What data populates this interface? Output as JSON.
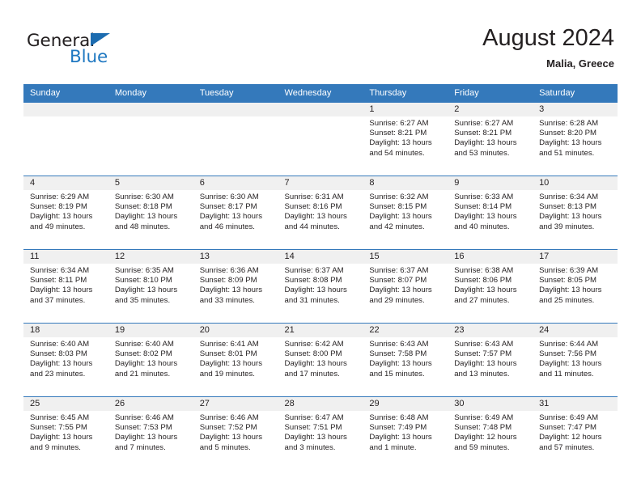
{
  "logo": {
    "word_top": "General",
    "word_bottom": "Blue",
    "triangle_color": "#1c6cb0",
    "blue_color": "#1f78c1"
  },
  "header": {
    "title": "August 2024",
    "subtitle": "Malia, Greece"
  },
  "theme": {
    "header_bg": "#3479bb",
    "daynum_bg": "#f0f0f0",
    "text": "#231f20",
    "grid_line": "#3479bb"
  },
  "weekday_headers": [
    "Sunday",
    "Monday",
    "Tuesday",
    "Wednesday",
    "Thursday",
    "Friday",
    "Saturday"
  ],
  "weeks": [
    [
      {
        "day": "",
        "empty": true
      },
      {
        "day": "",
        "empty": true
      },
      {
        "day": "",
        "empty": true
      },
      {
        "day": "",
        "empty": true
      },
      {
        "day": "1",
        "sunrise": "Sunrise: 6:27 AM",
        "sunset": "Sunset: 8:21 PM",
        "daylight": "Daylight: 13 hours and 54 minutes."
      },
      {
        "day": "2",
        "sunrise": "Sunrise: 6:27 AM",
        "sunset": "Sunset: 8:21 PM",
        "daylight": "Daylight: 13 hours and 53 minutes."
      },
      {
        "day": "3",
        "sunrise": "Sunrise: 6:28 AM",
        "sunset": "Sunset: 8:20 PM",
        "daylight": "Daylight: 13 hours and 51 minutes."
      }
    ],
    [
      {
        "day": "4",
        "sunrise": "Sunrise: 6:29 AM",
        "sunset": "Sunset: 8:19 PM",
        "daylight": "Daylight: 13 hours and 49 minutes."
      },
      {
        "day": "5",
        "sunrise": "Sunrise: 6:30 AM",
        "sunset": "Sunset: 8:18 PM",
        "daylight": "Daylight: 13 hours and 48 minutes."
      },
      {
        "day": "6",
        "sunrise": "Sunrise: 6:30 AM",
        "sunset": "Sunset: 8:17 PM",
        "daylight": "Daylight: 13 hours and 46 minutes."
      },
      {
        "day": "7",
        "sunrise": "Sunrise: 6:31 AM",
        "sunset": "Sunset: 8:16 PM",
        "daylight": "Daylight: 13 hours and 44 minutes."
      },
      {
        "day": "8",
        "sunrise": "Sunrise: 6:32 AM",
        "sunset": "Sunset: 8:15 PM",
        "daylight": "Daylight: 13 hours and 42 minutes."
      },
      {
        "day": "9",
        "sunrise": "Sunrise: 6:33 AM",
        "sunset": "Sunset: 8:14 PM",
        "daylight": "Daylight: 13 hours and 40 minutes."
      },
      {
        "day": "10",
        "sunrise": "Sunrise: 6:34 AM",
        "sunset": "Sunset: 8:13 PM",
        "daylight": "Daylight: 13 hours and 39 minutes."
      }
    ],
    [
      {
        "day": "11",
        "sunrise": "Sunrise: 6:34 AM",
        "sunset": "Sunset: 8:11 PM",
        "daylight": "Daylight: 13 hours and 37 minutes."
      },
      {
        "day": "12",
        "sunrise": "Sunrise: 6:35 AM",
        "sunset": "Sunset: 8:10 PM",
        "daylight": "Daylight: 13 hours and 35 minutes."
      },
      {
        "day": "13",
        "sunrise": "Sunrise: 6:36 AM",
        "sunset": "Sunset: 8:09 PM",
        "daylight": "Daylight: 13 hours and 33 minutes."
      },
      {
        "day": "14",
        "sunrise": "Sunrise: 6:37 AM",
        "sunset": "Sunset: 8:08 PM",
        "daylight": "Daylight: 13 hours and 31 minutes."
      },
      {
        "day": "15",
        "sunrise": "Sunrise: 6:37 AM",
        "sunset": "Sunset: 8:07 PM",
        "daylight": "Daylight: 13 hours and 29 minutes."
      },
      {
        "day": "16",
        "sunrise": "Sunrise: 6:38 AM",
        "sunset": "Sunset: 8:06 PM",
        "daylight": "Daylight: 13 hours and 27 minutes."
      },
      {
        "day": "17",
        "sunrise": "Sunrise: 6:39 AM",
        "sunset": "Sunset: 8:05 PM",
        "daylight": "Daylight: 13 hours and 25 minutes."
      }
    ],
    [
      {
        "day": "18",
        "sunrise": "Sunrise: 6:40 AM",
        "sunset": "Sunset: 8:03 PM",
        "daylight": "Daylight: 13 hours and 23 minutes."
      },
      {
        "day": "19",
        "sunrise": "Sunrise: 6:40 AM",
        "sunset": "Sunset: 8:02 PM",
        "daylight": "Daylight: 13 hours and 21 minutes."
      },
      {
        "day": "20",
        "sunrise": "Sunrise: 6:41 AM",
        "sunset": "Sunset: 8:01 PM",
        "daylight": "Daylight: 13 hours and 19 minutes."
      },
      {
        "day": "21",
        "sunrise": "Sunrise: 6:42 AM",
        "sunset": "Sunset: 8:00 PM",
        "daylight": "Daylight: 13 hours and 17 minutes."
      },
      {
        "day": "22",
        "sunrise": "Sunrise: 6:43 AM",
        "sunset": "Sunset: 7:58 PM",
        "daylight": "Daylight: 13 hours and 15 minutes."
      },
      {
        "day": "23",
        "sunrise": "Sunrise: 6:43 AM",
        "sunset": "Sunset: 7:57 PM",
        "daylight": "Daylight: 13 hours and 13 minutes."
      },
      {
        "day": "24",
        "sunrise": "Sunrise: 6:44 AM",
        "sunset": "Sunset: 7:56 PM",
        "daylight": "Daylight: 13 hours and 11 minutes."
      }
    ],
    [
      {
        "day": "25",
        "sunrise": "Sunrise: 6:45 AM",
        "sunset": "Sunset: 7:55 PM",
        "daylight": "Daylight: 13 hours and 9 minutes."
      },
      {
        "day": "26",
        "sunrise": "Sunrise: 6:46 AM",
        "sunset": "Sunset: 7:53 PM",
        "daylight": "Daylight: 13 hours and 7 minutes."
      },
      {
        "day": "27",
        "sunrise": "Sunrise: 6:46 AM",
        "sunset": "Sunset: 7:52 PM",
        "daylight": "Daylight: 13 hours and 5 minutes."
      },
      {
        "day": "28",
        "sunrise": "Sunrise: 6:47 AM",
        "sunset": "Sunset: 7:51 PM",
        "daylight": "Daylight: 13 hours and 3 minutes."
      },
      {
        "day": "29",
        "sunrise": "Sunrise: 6:48 AM",
        "sunset": "Sunset: 7:49 PM",
        "daylight": "Daylight: 13 hours and 1 minute."
      },
      {
        "day": "30",
        "sunrise": "Sunrise: 6:49 AM",
        "sunset": "Sunset: 7:48 PM",
        "daylight": "Daylight: 12 hours and 59 minutes."
      },
      {
        "day": "31",
        "sunrise": "Sunrise: 6:49 AM",
        "sunset": "Sunset: 7:47 PM",
        "daylight": "Daylight: 12 hours and 57 minutes."
      }
    ]
  ]
}
